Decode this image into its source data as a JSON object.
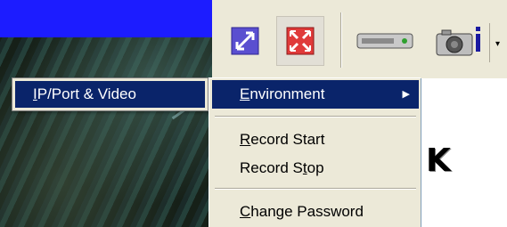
{
  "submenu": {
    "label_pre": "",
    "label_u": "I",
    "label_post": "P/Port & Video"
  },
  "menu": {
    "environment": {
      "u": "E",
      "rest": "nvironment"
    },
    "record_start": {
      "u": "R",
      "rest": "ecord Start"
    },
    "record_stop": {
      "pre": "Record S",
      "u": "t",
      "rest": "op"
    },
    "change_password": {
      "u": "C",
      "rest": "hange Password"
    }
  },
  "toolbar": {
    "icons": [
      "resize-icon",
      "fullscreen-icon",
      "device-icon",
      "camera-icon",
      "dropdown-arrow-icon"
    ],
    "dropdown_glyph": "▾"
  },
  "panel": {
    "letter": "K"
  },
  "colors": {
    "highlight": "#0a246a",
    "title_blue": "#1c1cff",
    "menu_bg": "#ece9d8"
  }
}
